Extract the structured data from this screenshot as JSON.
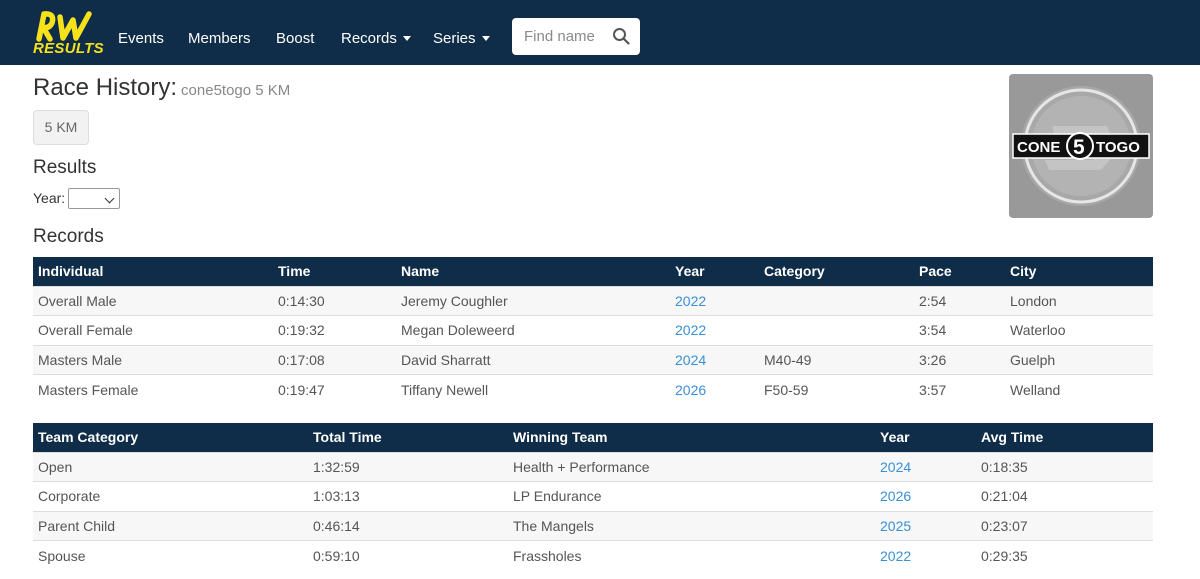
{
  "nav": {
    "logo_text": "RESULTS",
    "items": [
      {
        "label": "Events"
      },
      {
        "label": "Members"
      },
      {
        "label": "Boost"
      },
      {
        "label": "Records"
      },
      {
        "label": "Series"
      }
    ],
    "search_placeholder": "Find name"
  },
  "page": {
    "title": "Race History:",
    "subtitle": "cone5togo 5 KM",
    "distance_button": "5 KM"
  },
  "race_logo": {
    "text_left": "CONE",
    "numeral": "5",
    "text_right": "TOGO"
  },
  "results": {
    "heading": "Results",
    "year_label": "Year:",
    "year_value": ""
  },
  "records": {
    "heading": "Records",
    "individual": {
      "columns": [
        "Individual",
        "Time",
        "Name",
        "Year",
        "Category",
        "Pace",
        "City"
      ],
      "rows": [
        [
          "Overall Male",
          "0:14:30",
          "Jeremy Coughler",
          "2022",
          "",
          "2:54",
          "London"
        ],
        [
          "Overall Female",
          "0:19:32",
          "Megan Doleweerd",
          "2022",
          "",
          "3:54",
          "Waterloo"
        ],
        [
          "Masters Male",
          "0:17:08",
          "David Sharratt",
          "2024",
          "M40-49",
          "3:26",
          "Guelph"
        ],
        [
          "Masters Female",
          "0:19:47",
          "Tiffany Newell",
          "2026",
          "F50-59",
          "3:57",
          "Welland"
        ]
      ]
    },
    "team": {
      "columns": [
        "Team Category",
        "Total Time",
        "Winning Team",
        "Year",
        "Avg Time"
      ],
      "rows": [
        [
          "Open",
          "1:32:59",
          "Health + Performance",
          "2024",
          "0:18:35"
        ],
        [
          "Corporate",
          "1:03:13",
          "LP Endurance",
          "2026",
          "0:21:04"
        ],
        [
          "Parent Child",
          "0:46:14",
          "The Mangels",
          "2025",
          "0:23:07"
        ],
        [
          "Spouse",
          "0:59:10",
          "Frassholes",
          "2022",
          "0:29:35"
        ]
      ]
    }
  },
  "colors": {
    "navbar": "#0f2c48",
    "logo_yellow": "#f5e21b",
    "link": "#3a8fd6",
    "row_stripe": "#f7f7f7"
  }
}
